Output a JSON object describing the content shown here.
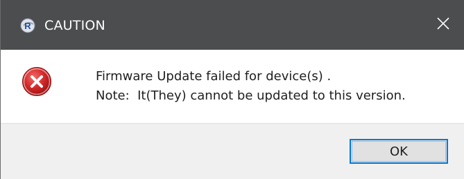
{
  "window": {
    "title": "CAUTION",
    "icon": "r-app-icon",
    "close_icon": "close-icon"
  },
  "message": {
    "icon": "error-icon",
    "line1": "Firmware Update failed for device(s) .",
    "line2": "Note:  It(They) cannot be updated to this version."
  },
  "buttons": {
    "ok_label": "OK"
  },
  "colors": {
    "titlebar": "#4b4d4f",
    "error_red": "#d13438",
    "button_focus_border": "#0078d7",
    "footer": "#f0f0f0"
  }
}
